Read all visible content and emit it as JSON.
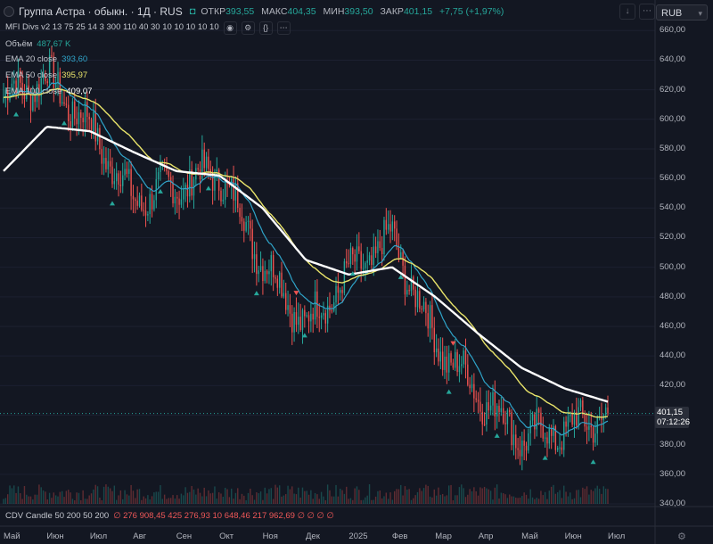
{
  "header": {
    "title": "Группа Астра · обыкн. · 1Д · RUS",
    "live_mark": "◘",
    "open_label": "ОТКР",
    "open_value": "393,55",
    "high_label": "МАКС",
    "high_value": "404,35",
    "low_label": "МИН",
    "low_value": "393,50",
    "close_label": "ЗАКР",
    "close_value": "401,15",
    "change": "+7,75 (+1,97%)",
    "currency": "RUB"
  },
  "indicators": {
    "mfi": "MFI Divs v2 13 75 25 14 3 300 110 40 30 10 10 10 10 10",
    "volume_label": "Объём",
    "volume_value": "487,67 K",
    "ema20_label": "EMA 20 close",
    "ema20_value": "393,60",
    "ema50_label": "EMA 50 close",
    "ema50_value": "395,97",
    "ema100_label": "EMA 100 close",
    "ema100_value": "409,07",
    "cdv_label": "CDV Candle 50 200 50 200",
    "cdv_values": "∅ 276 908,45  425 276,93  10 648,46  217 962,69  ∅ ∅ ∅ ∅"
  },
  "price_tag": {
    "price": "401,15",
    "countdown": "07:12:26"
  },
  "colors": {
    "background": "#131722",
    "up": "#26a69a",
    "down": "#ef5350",
    "ema20": "#2fa4c9",
    "ema50": "#e9e46a",
    "ema100": "#ffffff",
    "signal_up": "#26a69a",
    "signal_down": "#ef5350"
  },
  "chart_data": {
    "type": "candlestick",
    "y_ticks": [
      "660,00",
      "640,00",
      "620,00",
      "600,00",
      "580,00",
      "560,00",
      "540,00",
      "520,00",
      "500,00",
      "480,00",
      "460,00",
      "440,00",
      "420,00",
      "400,00",
      "380,00",
      "360,00",
      "340,00"
    ],
    "x_ticks": [
      "Май",
      "Июн",
      "Июл",
      "Авг",
      "Сен",
      "Окт",
      "Ноя",
      "Дек",
      "2025",
      "Фев",
      "Мар",
      "Апр",
      "Май",
      "Июн",
      "Июл"
    ],
    "ylim": [
      340,
      665
    ],
    "timeline": [
      "2024-05",
      "2024-06",
      "2024-07",
      "2024-08",
      "2024-09",
      "2024-10",
      "2024-11",
      "2024-12",
      "2025-01",
      "2025-02",
      "2025-03",
      "2025-04",
      "2025-05",
      "2025-06",
      "2025-07"
    ],
    "close_anchors": [
      {
        "month": "2024-05",
        "close": 615
      },
      {
        "month": "2024-06",
        "close": 628
      },
      {
        "month": "2024-07",
        "close": 595
      },
      {
        "month": "2024-08",
        "close": 545
      },
      {
        "month": "2024-09",
        "close": 555
      },
      {
        "month": "2024-10",
        "close": 565
      },
      {
        "month": "2024-11",
        "close": 505
      },
      {
        "month": "2024-12",
        "close": 460
      },
      {
        "month": "2025-01",
        "close": 495
      },
      {
        "month": "2025-02",
        "close": 520
      },
      {
        "month": "2025-03",
        "close": 450
      },
      {
        "month": "2025-04",
        "close": 415
      },
      {
        "month": "2025-05",
        "close": 385
      },
      {
        "month": "2025-06",
        "close": 390
      },
      {
        "month": "2025-07",
        "close": 401.15
      }
    ],
    "ema100_anchors": [
      {
        "month": "2024-05",
        "value": 565
      },
      {
        "month": "2024-06",
        "value": 595
      },
      {
        "month": "2024-07",
        "value": 592
      },
      {
        "month": "2024-08",
        "value": 578
      },
      {
        "month": "2024-09",
        "value": 565
      },
      {
        "month": "2024-10",
        "value": 562
      },
      {
        "month": "2024-11",
        "value": 540
      },
      {
        "month": "2024-12",
        "value": 505
      },
      {
        "month": "2025-01",
        "value": 495
      },
      {
        "month": "2025-02",
        "value": 500
      },
      {
        "month": "2025-03",
        "value": 480
      },
      {
        "month": "2025-04",
        "value": 455
      },
      {
        "month": "2025-05",
        "value": 432
      },
      {
        "month": "2025-06",
        "value": 418
      },
      {
        "month": "2025-07",
        "value": 409.07
      }
    ],
    "last": 401.15
  }
}
